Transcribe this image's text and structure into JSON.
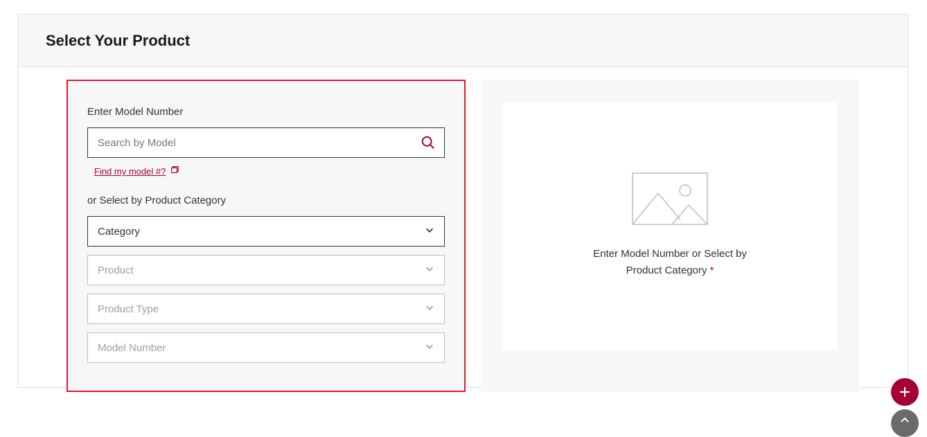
{
  "header": {
    "title": "Select Your Product"
  },
  "leftPanel": {
    "modelLabel": "Enter Model Number",
    "searchPlaceholder": "Search by Model",
    "findModelLink": "Find my model #?",
    "categoryLabel": "or Select by Product Category",
    "selects": [
      {
        "label": "Category",
        "enabled": true
      },
      {
        "label": "Product",
        "enabled": false
      },
      {
        "label": "Product Type",
        "enabled": false
      },
      {
        "label": "Model Number",
        "enabled": false
      }
    ]
  },
  "rightPanel": {
    "line1": "Enter Model Number or Select by",
    "line2": "Product Category",
    "required": "*"
  },
  "colors": {
    "brand": "#a50034",
    "highlight": "#e11931"
  }
}
